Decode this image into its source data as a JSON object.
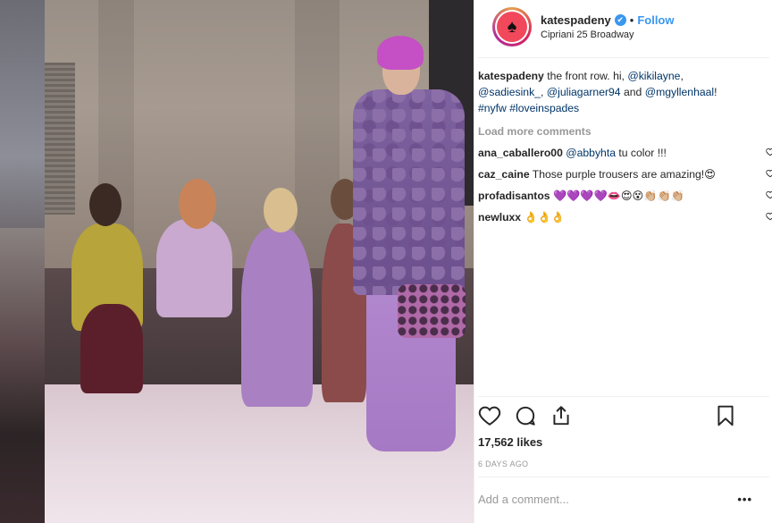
{
  "post": {
    "username": "katespadeny",
    "verified_mark": "✔",
    "separator": "•",
    "follow_label": "Follow",
    "location": "Cipriani 25 Broadway",
    "avatar_glyph": "♠",
    "caption": {
      "author": "katespadeny",
      "text_1": " the front row. hi, ",
      "mention_1": "@kikilayne",
      "text_2": ", ",
      "mention_2": "@sadiesink_",
      "text_3": ", ",
      "mention_3": "@juliagarner94",
      "text_4": " and ",
      "mention_4": "@mgyllenhaal",
      "text_5": "! ",
      "hashtag_1": "#nyfw",
      "text_6": " ",
      "hashtag_2": "#loveinspades"
    },
    "load_more_label": "Load more comments",
    "comments": [
      {
        "author": "ana_caballero00",
        "mention": "@abbyhta",
        "text": " tu color !!!"
      },
      {
        "author": "caz_caine",
        "text": " Those purple trousers are amazing!😍"
      },
      {
        "author": "profadisantos",
        "text": " 💜💜💜💜👄😍😵👏🏼👏🏼👏🏼"
      },
      {
        "author": "newluxx",
        "text": " 👌👌👌"
      }
    ],
    "likes": "17,562 likes",
    "age": "6 DAYS AGO",
    "add_comment_placeholder": "Add a comment...",
    "more_label": "•••"
  },
  "icons": {
    "like": "heart-icon",
    "comment": "speech-bubble-icon",
    "share": "share-icon",
    "save": "bookmark-icon"
  },
  "colors": {
    "link_blue": "#3897f0",
    "mention_blue": "#003569",
    "muted_gray": "#999999",
    "text_dark": "#262626"
  }
}
